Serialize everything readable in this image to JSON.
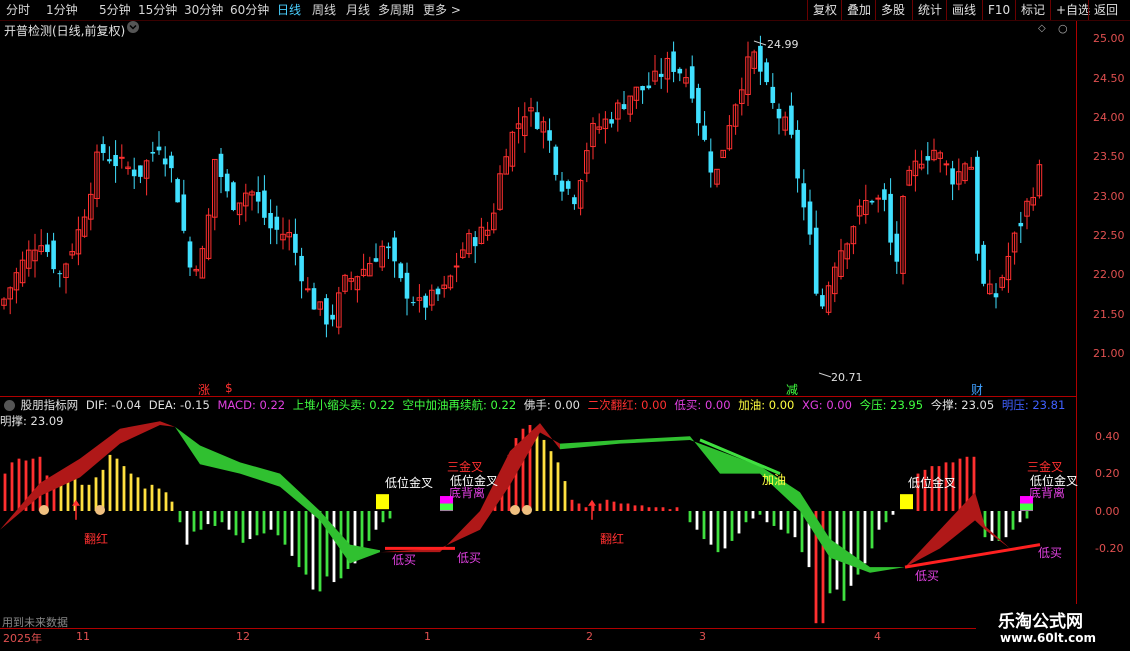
{
  "toolbar": {
    "periods": [
      "分时",
      "1分钟",
      "5分钟",
      "15分钟",
      "30分钟",
      "60分钟",
      "日线",
      "周线",
      "月线",
      "多周期",
      "更多 >"
    ],
    "active": "日线",
    "actions": [
      "复权",
      "叠加",
      "多股",
      "统计",
      "画线",
      "F10",
      "标记",
      "+自选",
      "返回"
    ]
  },
  "main_chart": {
    "title": "开普检测(日线,前复权)",
    "high_label": "24.99",
    "low_label": "20.71",
    "price_ticks": [
      "25.00",
      "24.50",
      "24.00",
      "23.50",
      "23.00",
      "22.50",
      "22.00",
      "21.50",
      "21.00"
    ],
    "markers": [
      {
        "text": "涨",
        "color": "#ff3030"
      },
      {
        "text": "$",
        "color": "#ff3030"
      },
      {
        "text": "减",
        "color": "#40ff40"
      },
      {
        "text": "财",
        "color": "#40a0ff"
      }
    ]
  },
  "indicator": {
    "name": "股朋指标网",
    "fields": [
      {
        "text": "DIF: -0.04",
        "color": "#e0e0e0"
      },
      {
        "text": "DEA: -0.15",
        "color": "#e0e0e0"
      },
      {
        "text": "MACD: 0.22",
        "color": "#e040e0"
      },
      {
        "text": "上堆小缩头卖: 0.22",
        "color": "#40ff40"
      },
      {
        "text": "空中加油再续航: 0.22",
        "color": "#40ff40"
      },
      {
        "text": "佛手: 0.00",
        "color": "#e0e0e0"
      },
      {
        "text": "二次翻红: 0.00",
        "color": "#ff3030"
      },
      {
        "text": "低买: 0.00",
        "color": "#e040e0"
      },
      {
        "text": "加油: 0.00",
        "color": "#ffff40"
      },
      {
        "text": "XG: 0.00",
        "color": "#e040e0"
      },
      {
        "text": "今压: 23.95",
        "color": "#40ff40"
      },
      {
        "text": "今撑: 23.05",
        "color": "#e0e0e0"
      },
      {
        "text": "明压: 23.81",
        "color": "#4060ff"
      },
      {
        "text": "明撑: 23.09",
        "color": "#e0e0e0"
      }
    ],
    "ticks": [
      "0.40",
      "0.20",
      "0.00",
      "-0.20"
    ],
    "annotations": [
      {
        "text": "翻红",
        "color": "#ff3030"
      },
      {
        "text": "翻红",
        "color": "#ff3030"
      },
      {
        "text": "低位金叉",
        "color": "#ffffff"
      },
      {
        "text": "低位金叉",
        "color": "#ffffff"
      },
      {
        "text": "低位金叉",
        "color": "#ffffff"
      },
      {
        "text": "低位金叉",
        "color": "#ffffff"
      },
      {
        "text": "三金叉",
        "color": "#ff3030"
      },
      {
        "text": "三金叉",
        "color": "#ff3030"
      },
      {
        "text": "底背离",
        "color": "#e040e0"
      },
      {
        "text": "底背离",
        "color": "#e040e0"
      },
      {
        "text": "低买",
        "color": "#e040e0"
      },
      {
        "text": "低买",
        "color": "#e040e0"
      },
      {
        "text": "低买",
        "color": "#e040e0"
      },
      {
        "text": "低买",
        "color": "#e040e0"
      },
      {
        "text": "加油",
        "color": "#ffff40"
      }
    ],
    "footnote": "用到未来数据"
  },
  "bottom_axis": {
    "labels": [
      "2025年",
      "11",
      "12",
      "1",
      "2",
      "3",
      "4"
    ]
  },
  "logo": {
    "line1": "乐淘公式网",
    "line2": "www.60lt.com"
  },
  "colors": {
    "up": "#ff3030",
    "down": "#40e0ff",
    "grid": "#b00000"
  }
}
